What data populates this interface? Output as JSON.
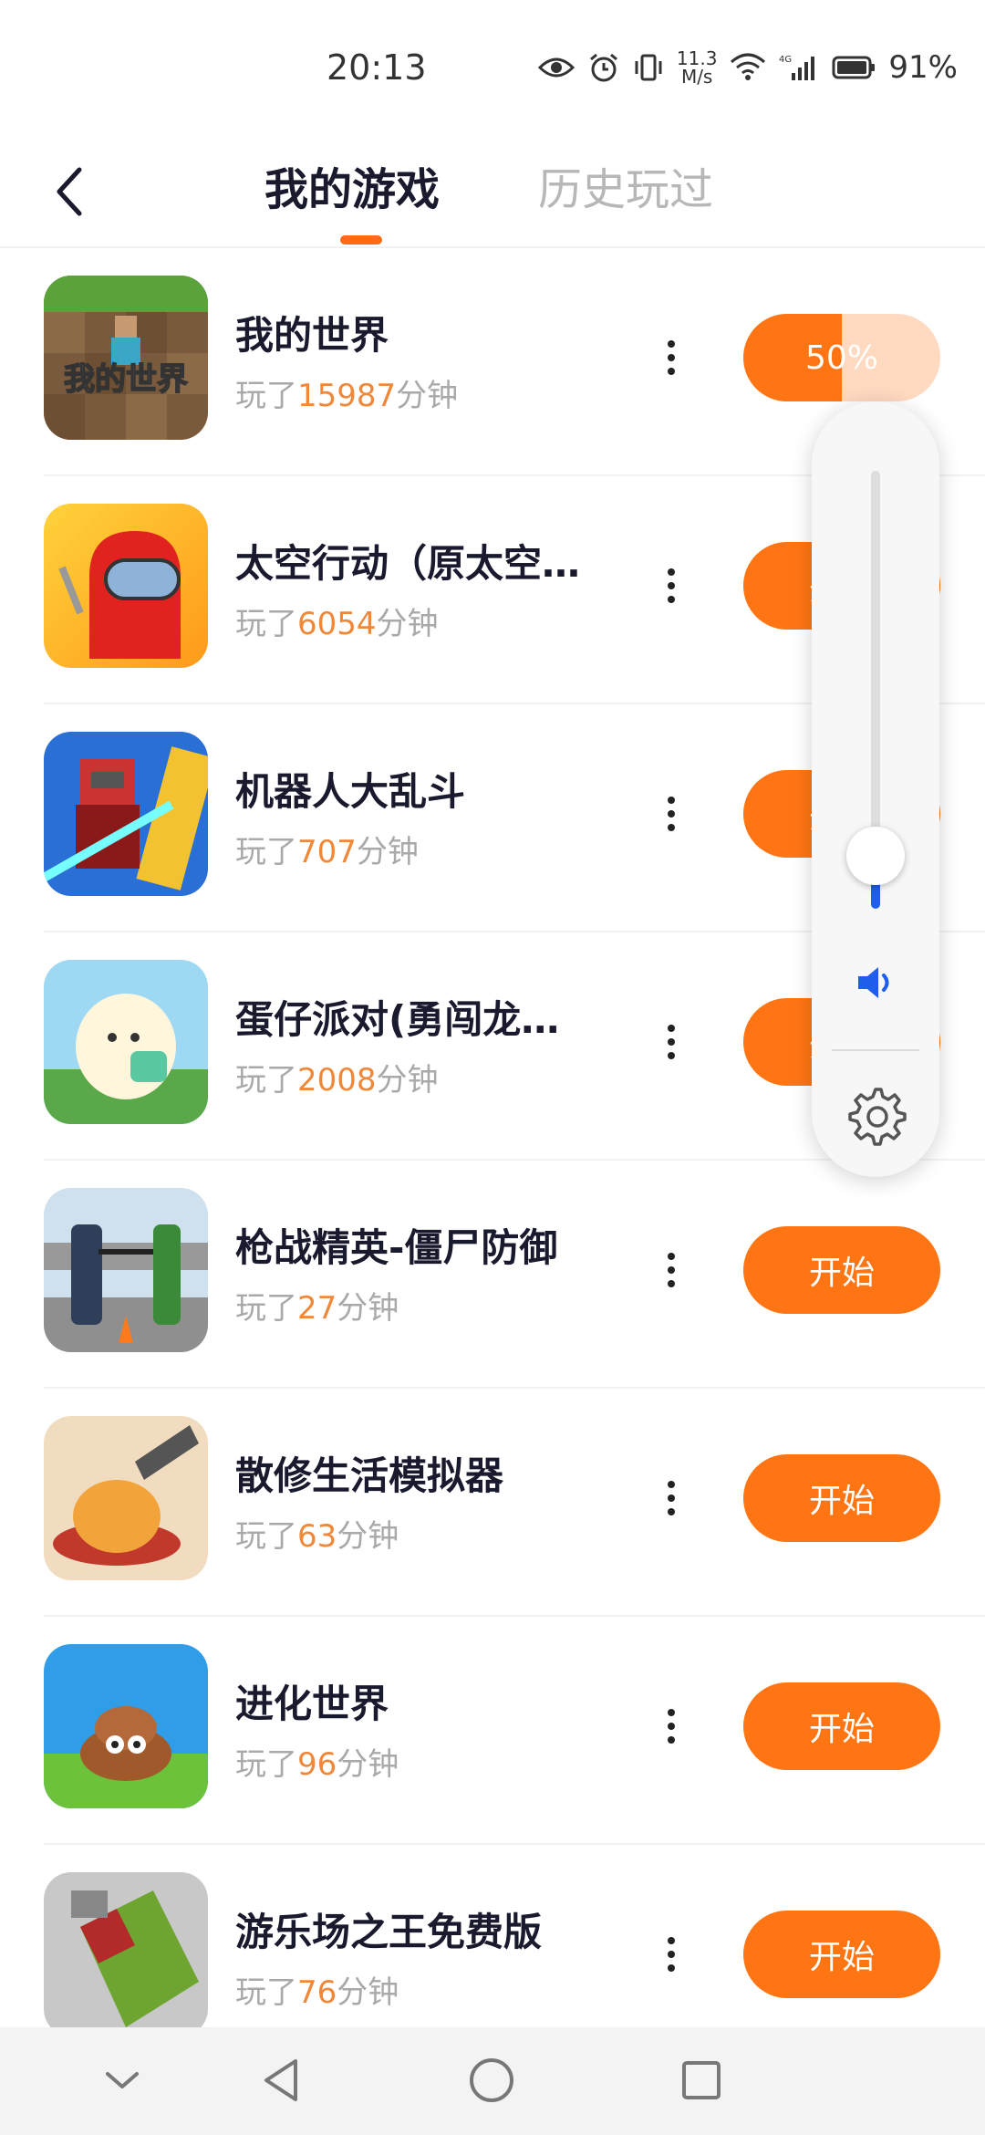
{
  "status_bar": {
    "time": "20:13",
    "net_speed_top": "11.3",
    "net_speed_bottom": "M/s",
    "battery_percent": "91%",
    "icons": [
      "eye-icon",
      "alarm-icon",
      "vibrate-icon",
      "wifi-icon",
      "signal-4g-icon",
      "battery-icon"
    ]
  },
  "header": {
    "back_icon": "chevron-left-icon",
    "tabs": [
      {
        "label": "我的游戏",
        "active": true
      },
      {
        "label": "历史玩过",
        "active": false
      }
    ]
  },
  "games": [
    {
      "name": "我的世界",
      "played_prefix": "玩了",
      "minutes": "15987",
      "played_suffix": "分钟",
      "button": "50%",
      "progress": 0.5
    },
    {
      "name": "太空行动（原太空…",
      "played_prefix": "玩了",
      "minutes": "6054",
      "played_suffix": "分钟",
      "button": "开始"
    },
    {
      "name": "机器人大乱斗",
      "played_prefix": "玩了",
      "minutes": "707",
      "played_suffix": "分钟",
      "button": "开始"
    },
    {
      "name": "蛋仔派对(勇闯龙…",
      "played_prefix": "玩了",
      "minutes": "2008",
      "played_suffix": "分钟",
      "button": "开始"
    },
    {
      "name": "枪战精英-僵尸防御",
      "played_prefix": "玩了",
      "minutes": "27",
      "played_suffix": "分钟",
      "button": "开始"
    },
    {
      "name": "散修生活模拟器",
      "played_prefix": "玩了",
      "minutes": "63",
      "played_suffix": "分钟",
      "button": "开始"
    },
    {
      "name": "进化世界",
      "played_prefix": "玩了",
      "minutes": "96",
      "played_suffix": "分钟",
      "button": "开始"
    },
    {
      "name": "游乐场之王免费版",
      "played_prefix": "玩了",
      "minutes": "76",
      "played_suffix": "分钟",
      "button": "开始"
    }
  ],
  "volume_panel": {
    "level": 0.12,
    "icons": [
      "speaker-icon",
      "settings-gear-icon"
    ]
  },
  "nav_bar": {
    "icons": [
      "collapse-icon",
      "back-triangle-icon",
      "home-circle-icon",
      "recents-square-icon"
    ]
  },
  "colors": {
    "accent": "#ff7514",
    "minutes_text": "#f0883a",
    "volume_blue": "#1f5eea"
  }
}
